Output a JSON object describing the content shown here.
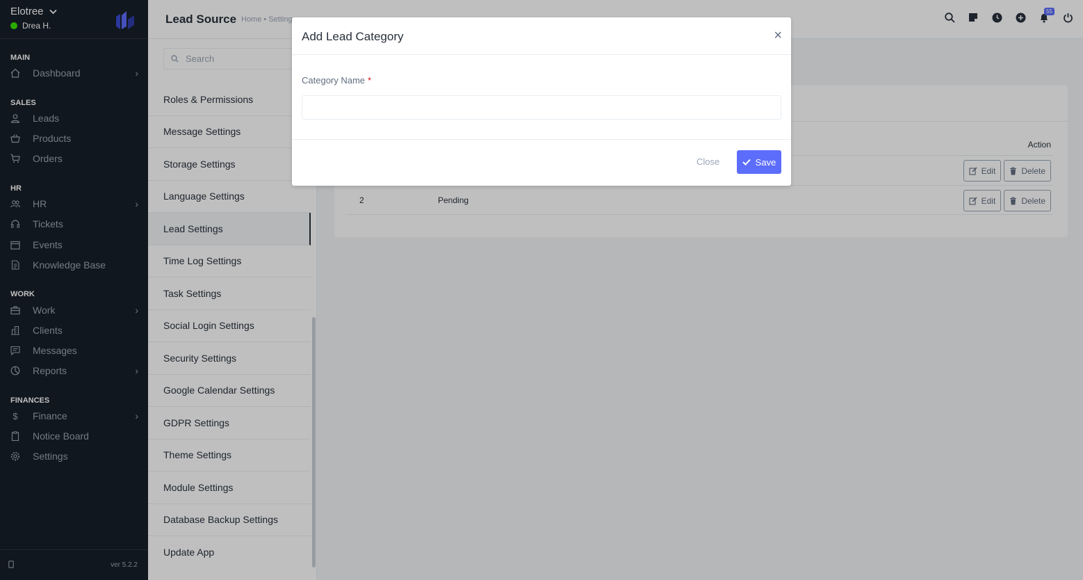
{
  "sidebar": {
    "company": "Elotree",
    "user": "Drea H.",
    "sections": {
      "main": "MAIN",
      "sales": "SALES",
      "hr": "HR",
      "work": "WORK",
      "finances": "FINANCES"
    },
    "items": {
      "dashboard": "Dashboard",
      "leads": "Leads",
      "products": "Products",
      "orders": "Orders",
      "hr": "HR",
      "tickets": "Tickets",
      "events": "Events",
      "knowledge_base": "Knowledge Base",
      "work": "Work",
      "clients": "Clients",
      "messages": "Messages",
      "reports": "Reports",
      "finance": "Finance",
      "notice_board": "Notice Board",
      "settings": "Settings"
    },
    "version": "ver 5.2.2"
  },
  "header": {
    "title": "Lead Source",
    "breadcrumb": "Home • Settings",
    "notification_count": "55"
  },
  "settings_menu": {
    "search_placeholder": "Search",
    "items": [
      "Roles & Permissions",
      "Message Settings",
      "Storage Settings",
      "Language Settings",
      "Lead Settings",
      "Time Log Settings",
      "Task Settings",
      "Social Login Settings",
      "Security Settings",
      "Google Calendar Settings",
      "GDPR Settings",
      "Theme Settings",
      "Module Settings",
      "Database Backup Settings",
      "Update App"
    ]
  },
  "table": {
    "action_header": "Action",
    "rows": [
      {
        "id": "",
        "name": ""
      },
      {
        "id": "2",
        "name": "Pending"
      }
    ],
    "edit_label": "Edit",
    "delete_label": "Delete"
  },
  "modal": {
    "title": "Add Lead Category",
    "field_label": "Category Name",
    "required_mark": "*",
    "field_value": "",
    "close_label": "Close",
    "save_label": "Save"
  },
  "colors": {
    "sidebar_bg": "#171f29",
    "accent": "#5d6dfb",
    "online": "#39e500",
    "required": "#d21010"
  }
}
